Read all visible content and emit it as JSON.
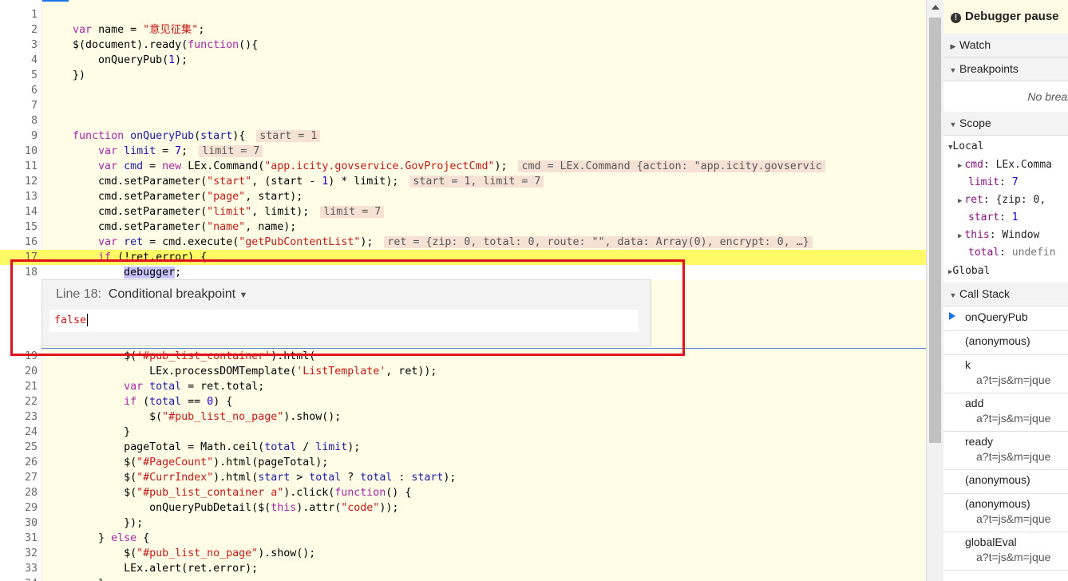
{
  "editor": {
    "lines": [
      {
        "n": "1",
        "parts": [],
        "inline": null
      },
      {
        "n": "2",
        "parts": [
          [
            "    ",
            ""
          ],
          [
            "var",
            "k"
          ],
          [
            " name = ",
            ""
          ],
          [
            "\"意见征集\"",
            "s"
          ],
          [
            ";",
            ""
          ]
        ],
        "inline": null
      },
      {
        "n": "3",
        "parts": [
          [
            "    $(document).ready(",
            ""
          ],
          [
            "function",
            "k"
          ],
          [
            "(){",
            ""
          ]
        ],
        "inline": null
      },
      {
        "n": "4",
        "parts": [
          [
            "        onQueryPub(",
            ""
          ],
          [
            "1",
            "n"
          ],
          [
            ");",
            ""
          ]
        ],
        "inline": null
      },
      {
        "n": "5",
        "parts": [
          [
            "    })",
            ""
          ]
        ],
        "inline": null
      },
      {
        "n": "6",
        "parts": [],
        "inline": null
      },
      {
        "n": "7",
        "parts": [],
        "inline": null
      },
      {
        "n": "8",
        "parts": [],
        "inline": null
      },
      {
        "n": "9",
        "parts": [
          [
            "    ",
            ""
          ],
          [
            "function",
            "k"
          ],
          [
            " ",
            ""
          ],
          [
            "onQueryPub",
            "v"
          ],
          [
            "(",
            ""
          ],
          [
            "start",
            "p"
          ],
          [
            "){",
            ""
          ]
        ],
        "inline": "start = 1"
      },
      {
        "n": "10",
        "parts": [
          [
            "        ",
            ""
          ],
          [
            "var",
            "k"
          ],
          [
            " ",
            ""
          ],
          [
            "limit",
            "v"
          ],
          [
            " = ",
            ""
          ],
          [
            "7",
            "n"
          ],
          [
            ";",
            ""
          ]
        ],
        "inline": "limit = 7"
      },
      {
        "n": "11",
        "parts": [
          [
            "        ",
            ""
          ],
          [
            "var",
            "k"
          ],
          [
            " ",
            ""
          ],
          [
            "cmd",
            "v"
          ],
          [
            " = ",
            ""
          ],
          [
            "new",
            "k"
          ],
          [
            " LEx.Command(",
            ""
          ],
          [
            "\"app.icity.govservice.GovProjectCmd\"",
            "s"
          ],
          [
            ");",
            ""
          ]
        ],
        "inline": "cmd = LEx.Command {action: \"app.icity.govservic"
      },
      {
        "n": "12",
        "parts": [
          [
            "        cmd.setParameter(",
            ""
          ],
          [
            "\"start\"",
            "s"
          ],
          [
            ", (start - ",
            ""
          ],
          [
            "1",
            "n"
          ],
          [
            ") * limit);",
            ""
          ]
        ],
        "inline": "start = 1, limit = 7"
      },
      {
        "n": "13",
        "parts": [
          [
            "        cmd.setParameter(",
            ""
          ],
          [
            "\"page\"",
            "s"
          ],
          [
            ", start);",
            ""
          ]
        ],
        "inline": null
      },
      {
        "n": "14",
        "parts": [
          [
            "        cmd.setParameter(",
            ""
          ],
          [
            "\"limit\"",
            "s"
          ],
          [
            ", limit);",
            ""
          ]
        ],
        "inline": "limit = 7"
      },
      {
        "n": "15",
        "parts": [
          [
            "        cmd.setParameter(",
            ""
          ],
          [
            "\"name\"",
            "s"
          ],
          [
            ", name);",
            ""
          ]
        ],
        "inline": null
      },
      {
        "n": "16",
        "parts": [
          [
            "        ",
            ""
          ],
          [
            "var",
            "k"
          ],
          [
            " ",
            ""
          ],
          [
            "ret",
            "v"
          ],
          [
            " = cmd.execute(",
            ""
          ],
          [
            "\"getPubContentList\"",
            "s"
          ],
          [
            ");",
            ""
          ]
        ],
        "inline": "ret = {zip: 0, total: 0, route: \"\", data: Array(0), encrypt: 0, …}"
      },
      {
        "n": "17",
        "parts": [
          [
            "        ",
            ""
          ],
          [
            "if",
            "k"
          ],
          [
            " (!ret.error) {",
            ""
          ]
        ],
        "inline": null
      },
      {
        "n": "18",
        "parts": [
          [
            "            ",
            ""
          ],
          [
            "debugger",
            "hl"
          ],
          [
            ";",
            ""
          ]
        ],
        "inline": null
      },
      {
        "n": "19",
        "parts": [
          [
            "            $(",
            ""
          ],
          [
            "'#pub_list_container'",
            "s"
          ],
          [
            ").html(",
            ""
          ]
        ],
        "inline": null
      },
      {
        "n": "20",
        "parts": [
          [
            "                LEx.processDOMTemplate(",
            ""
          ],
          [
            "'ListTemplate'",
            "s"
          ],
          [
            ", ret));",
            ""
          ]
        ],
        "inline": null
      },
      {
        "n": "21",
        "parts": [
          [
            "            ",
            ""
          ],
          [
            "var",
            "k"
          ],
          [
            " ",
            ""
          ],
          [
            "total",
            "v"
          ],
          [
            " = ret.total;",
            ""
          ]
        ],
        "inline": null
      },
      {
        "n": "22",
        "parts": [
          [
            "            ",
            ""
          ],
          [
            "if",
            "k"
          ],
          [
            " (",
            ""
          ],
          [
            "total",
            "v"
          ],
          [
            " == ",
            ""
          ],
          [
            "0",
            "n"
          ],
          [
            ") {",
            ""
          ]
        ],
        "inline": null
      },
      {
        "n": "23",
        "parts": [
          [
            "                $(",
            ""
          ],
          [
            "\"#pub_list_no_page\"",
            "s"
          ],
          [
            ").show();",
            ""
          ]
        ],
        "inline": null
      },
      {
        "n": "24",
        "parts": [
          [
            "            }",
            ""
          ]
        ],
        "inline": null
      },
      {
        "n": "25",
        "parts": [
          [
            "            pageTotal = Math.ceil(",
            ""
          ],
          [
            "total",
            "v"
          ],
          [
            " / ",
            ""
          ],
          [
            "limit",
            "v"
          ],
          [
            ");",
            ""
          ]
        ],
        "inline": null
      },
      {
        "n": "26",
        "parts": [
          [
            "            $(",
            ""
          ],
          [
            "\"#PageCount\"",
            "s"
          ],
          [
            ").html(pageTotal);",
            ""
          ]
        ],
        "inline": null
      },
      {
        "n": "27",
        "parts": [
          [
            "            $(",
            ""
          ],
          [
            "\"#CurrIndex\"",
            "s"
          ],
          [
            ").html(",
            ""
          ],
          [
            "start",
            "p"
          ],
          [
            " > ",
            ""
          ],
          [
            "total",
            "v"
          ],
          [
            " ? ",
            ""
          ],
          [
            "total",
            "v"
          ],
          [
            " : ",
            ""
          ],
          [
            "start",
            "p"
          ],
          [
            ");",
            ""
          ]
        ],
        "inline": null
      },
      {
        "n": "28",
        "parts": [
          [
            "            $(",
            ""
          ],
          [
            "\"#pub_list_container a\"",
            "s"
          ],
          [
            ").click(",
            ""
          ],
          [
            "function",
            "k"
          ],
          [
            "() {",
            ""
          ]
        ],
        "inline": null
      },
      {
        "n": "29",
        "parts": [
          [
            "                onQueryPubDetail($(",
            ""
          ],
          [
            "this",
            "k"
          ],
          [
            ").attr(",
            ""
          ],
          [
            "\"code\"",
            "s"
          ],
          [
            "));",
            ""
          ]
        ],
        "inline": null
      },
      {
        "n": "30",
        "parts": [
          [
            "            });",
            ""
          ]
        ],
        "inline": null
      },
      {
        "n": "31",
        "parts": [
          [
            "        } ",
            ""
          ],
          [
            "else",
            "k"
          ],
          [
            " {",
            ""
          ]
        ],
        "inline": null
      },
      {
        "n": "32",
        "parts": [
          [
            "            $(",
            ""
          ],
          [
            "\"#pub_list_no_page\"",
            "s"
          ],
          [
            ").show();",
            ""
          ]
        ],
        "inline": null
      },
      {
        "n": "33",
        "parts": [
          [
            "            LEx.alert(ret.error);",
            ""
          ]
        ],
        "inline": null
      },
      {
        "n": "34",
        "parts": [
          [
            "        }",
            ""
          ]
        ],
        "inline": null
      }
    ],
    "breakpoint_editor": {
      "line_label": "Line 18:",
      "type_label": "Conditional breakpoint",
      "dropdown_glyph": "▼",
      "condition": "false"
    }
  },
  "sidebar": {
    "paused_label": "Debugger pause",
    "watch_label": "Watch",
    "breakpoints_label": "Breakpoints",
    "no_breakpoints_text": "No breakp",
    "scope_label": "Scope",
    "local_label": "Local",
    "scope_items": [
      {
        "expand": "▶",
        "key": "cmd",
        "value": "LEx.Comma",
        "vtype": "obj"
      },
      {
        "expand": "",
        "key": "limit",
        "value": "7",
        "vtype": "num"
      },
      {
        "expand": "▶",
        "key": "ret",
        "value": "{zip: 0,",
        "vtype": "obj"
      },
      {
        "expand": "",
        "key": "start",
        "value": "1",
        "vtype": "num"
      },
      {
        "expand": "▶",
        "key": "this",
        "value": "Window",
        "vtype": "obj"
      },
      {
        "expand": "",
        "key": "total",
        "value": "undefin",
        "vtype": "undef"
      }
    ],
    "global_label": "Global",
    "call_stack_label": "Call Stack",
    "call_stack": [
      {
        "fn": "onQueryPub",
        "src": "",
        "current": true
      },
      {
        "fn": "(anonymous)",
        "src": "",
        "current": false
      },
      {
        "fn": "k",
        "src": "a?t=js&m=jque",
        "current": false
      },
      {
        "fn": "add",
        "src": "a?t=js&m=jque",
        "current": false
      },
      {
        "fn": "ready",
        "src": "a?t=js&m=jque",
        "current": false
      },
      {
        "fn": "(anonymous)",
        "src": "",
        "current": false
      },
      {
        "fn": "(anonymous)",
        "src": "a?t=js&m=jque",
        "current": false
      },
      {
        "fn": "globalEval",
        "src": "a?t=js&m=jque",
        "current": false
      }
    ]
  }
}
